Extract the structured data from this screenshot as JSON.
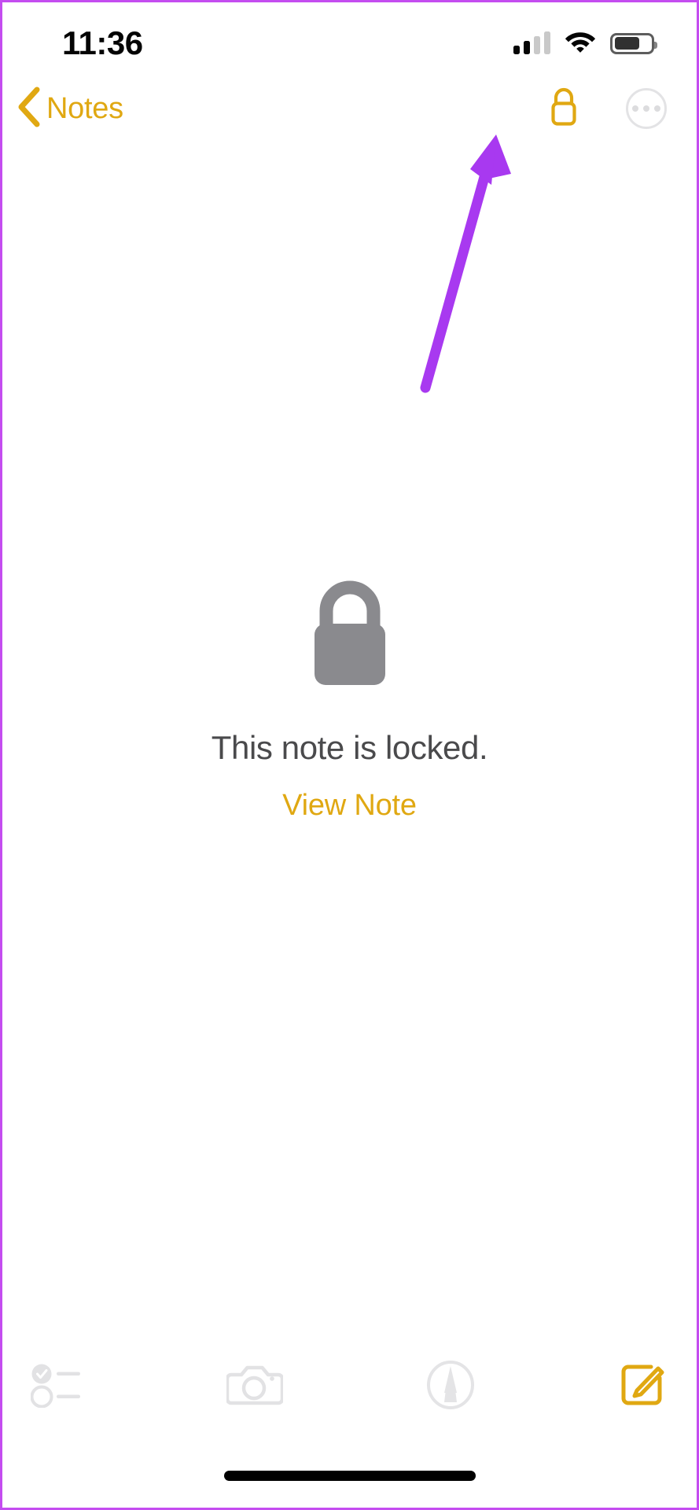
{
  "device": {
    "frame_color": "#c44df0"
  },
  "status_bar": {
    "time": "11:36",
    "signal_icon": "cellular-signal-icon",
    "signal_bars_filled": 2,
    "signal_bars_total": 4,
    "wifi_icon": "wifi-icon",
    "battery_icon": "battery-icon",
    "battery_level_percent": 62
  },
  "nav_bar": {
    "back_icon": "chevron-left-icon",
    "back_label": "Notes",
    "lock_icon": "lock-closed-icon",
    "more_icon": "ellipsis-circle-icon",
    "accent_color": "#e0a812"
  },
  "annotation": {
    "arrow_icon": "arrow-up-right-icon",
    "arrow_color": "#a839f0",
    "points_to": "lock-closed-icon"
  },
  "locked_content": {
    "lock_icon": "lock-closed-large-icon",
    "lock_icon_color": "#8a8a8e",
    "title": "This note is locked.",
    "title_color": "#4a4a4c",
    "action_label": "View Note",
    "action_color": "#e0a812"
  },
  "bottom_toolbar": {
    "items": [
      {
        "icon": "checklist-icon",
        "label": "Checklist",
        "enabled": false,
        "color": "#e2e2e4"
      },
      {
        "icon": "camera-icon",
        "label": "Camera",
        "enabled": false,
        "color": "#e2e2e4"
      },
      {
        "icon": "markup-pen-icon",
        "label": "Markup",
        "enabled": false,
        "color": "#e4e4e6"
      },
      {
        "icon": "compose-icon",
        "label": "New Note",
        "enabled": true,
        "color": "#e0a812"
      }
    ]
  },
  "home_indicator": {
    "icon": "home-indicator-bar"
  }
}
